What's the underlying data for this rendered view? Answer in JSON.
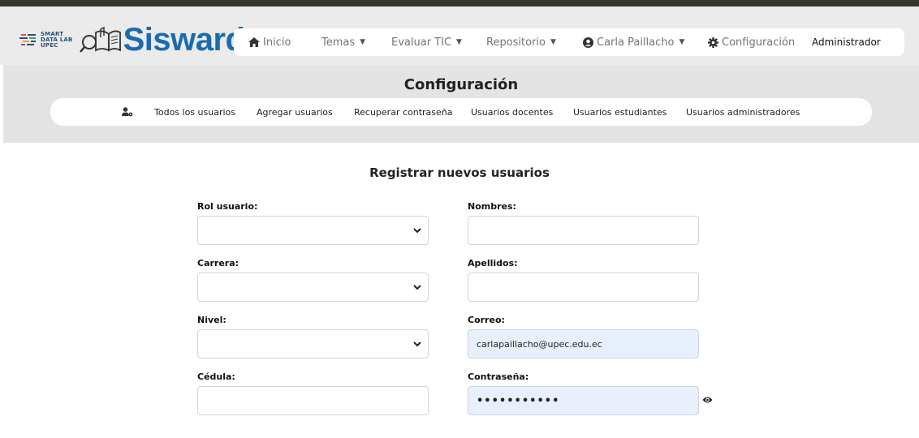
{
  "app": {
    "brand_small": [
      "SMART",
      "DATA LAB",
      "UPEC"
    ],
    "brand": "Sisward"
  },
  "nav": {
    "inicio": "Inicio",
    "temas": "Temas",
    "evaluar": "Evaluar TIC",
    "repositorio": "Repositorio",
    "user": "Carla Paillacho",
    "config": "Configuración",
    "role": "Administrador"
  },
  "config": {
    "title": "Configuración",
    "subnav": [
      "Todos los usuarios",
      "Agregar usuarios",
      "Recuperar contraseña",
      "Usuarios docentes",
      "Usuarios estudiantes",
      "Usuarios administradores"
    ]
  },
  "form": {
    "title": "Registrar nuevos usuarios",
    "rol_label": "Rol usuario:",
    "carrera_label": "Carrera:",
    "nivel_label": "Nivel:",
    "cedula_label": "Cédula:",
    "nombres_label": "Nombres:",
    "apellidos_label": "Apellidos:",
    "correo_label": "Correo:",
    "correo_value": "carlapaillacho@upec.edu.ec",
    "contrasena_label": "Contraseña:",
    "contrasena_value": "•••••••••••"
  },
  "icons": {
    "home": "home-icon",
    "user": "user-circle-icon",
    "gear": "gear-icon",
    "users": "users-cog-icon",
    "eye": "eye-icon"
  },
  "colors": {
    "brand_blue": "#1a6cae",
    "autofill": "#e8f0fe",
    "topbar": "#36362a"
  }
}
